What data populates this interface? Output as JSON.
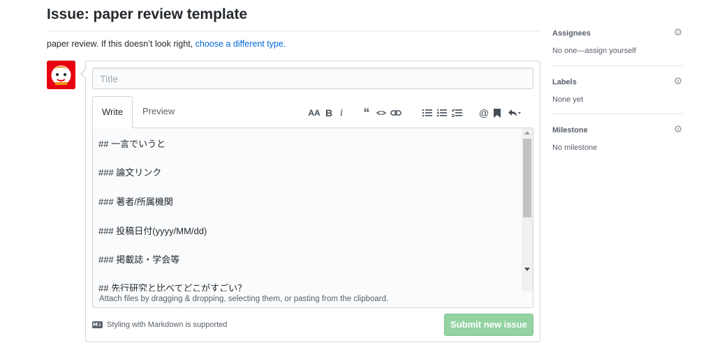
{
  "page": {
    "title": "Issue: paper review template",
    "subtitle_text": "paper review. If this doesn’t look right, ",
    "subtitle_link": "choose a different type."
  },
  "composer": {
    "title_placeholder": "Title",
    "tabs": [
      {
        "label": "Write"
      },
      {
        "label": "Preview"
      }
    ],
    "toolbar": {
      "heading": "AA",
      "bold": "B",
      "italic": "i",
      "quote": "“",
      "code": "<>",
      "link": "⊘",
      "bullet_list": "☰",
      "numbered_list": "☰",
      "task_list": "☑",
      "mention": "@",
      "saved_reply": "🔖",
      "reply": "↶"
    },
    "icons": [
      "text-size-icon",
      "bold-icon",
      "italic-icon",
      "quote-icon",
      "code-icon",
      "link-icon",
      "unordered-list-icon",
      "ordered-list-icon",
      "task-list-icon",
      "mention-icon",
      "bookmark-icon",
      "reply-icon"
    ],
    "body_lines": [
      "## 一言でいうと",
      "### 論文リンク",
      "### 著者/所属機関",
      "### 投稿日付(yyyy/MM/dd)",
      "### 掲載誌・学会等",
      "## 先行研究と比べてどこがすごい？"
    ],
    "attach_hint": "Attach files by dragging & dropping, selecting them, or pasting from the clipboard.",
    "markdown_note": "Styling with Markdown is supported",
    "submit_label": "Submit new issue"
  },
  "sidebar": {
    "assignees": {
      "label": "Assignees",
      "value": "No one—assign yourself"
    },
    "labels": {
      "label": "Labels",
      "value": "None yet"
    },
    "milestone": {
      "label": "Milestone",
      "value": "No milestone"
    }
  },
  "colors": {
    "link": "#0366d6",
    "submit_disabled": "#94d3a2",
    "avatar_bg": "#e60012"
  }
}
